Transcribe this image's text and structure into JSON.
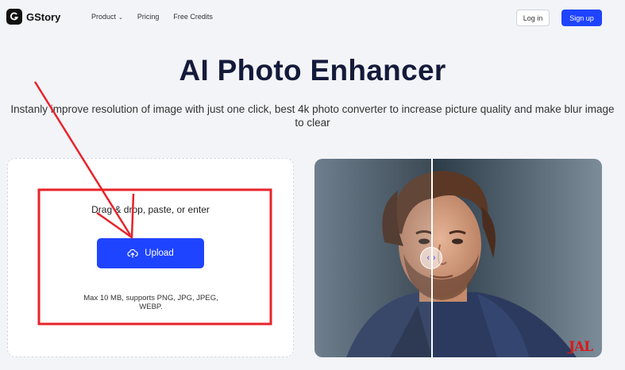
{
  "nav": {
    "logo": "GStory",
    "links": [
      {
        "label": "Product",
        "has_caret": true
      },
      {
        "label": "Pricing",
        "has_caret": false
      },
      {
        "label": "Free Credits",
        "has_caret": false
      }
    ],
    "login_label": "Log in",
    "signup_label": "Sign up"
  },
  "hero": {
    "title": "AI Photo Enhancer",
    "subtitle": "Instanly improve resolution of image with just one click, best 4k photo converter to increase picture quality and make blur image to clear"
  },
  "upload": {
    "drop_text": "Drag & drop, paste, or enter",
    "button_label": "Upload",
    "button_icon": "cloud-upload-icon",
    "limits_text": "Max 10 MB, supports PNG, JPG, JPEG, WEBP."
  },
  "compare": {
    "handle_left": "‹",
    "handle_right": "›",
    "watermark": "JAL"
  },
  "colors": {
    "accent": "#1f44ff",
    "annotation": "#e8232a",
    "background": "#f3f4f8"
  }
}
